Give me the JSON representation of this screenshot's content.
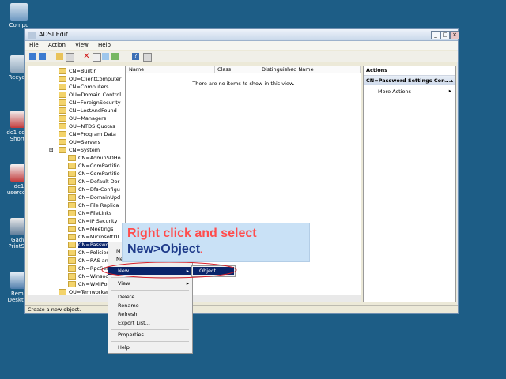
{
  "desktop": {
    "icons": [
      {
        "label": "Compu",
        "icon": "computer-icon"
      },
      {
        "label": "Recycle",
        "icon": "recycle-bin-icon"
      },
      {
        "label": "dc1 cons\nShortc",
        "icon": "shortcut-icon"
      },
      {
        "label": "dc1\nusercore",
        "icon": "shortcut-icon"
      },
      {
        "label": "Gadw\nPrintScr",
        "icon": "print-icon"
      },
      {
        "label": "Remo\nDesktop",
        "icon": "remote-desktop-icon"
      }
    ]
  },
  "window": {
    "title": "ADSI Edit",
    "menu": [
      "File",
      "Action",
      "View",
      "Help"
    ]
  },
  "tree": {
    "rows": [
      "CN=Builtin",
      "OU=ClientComputer",
      "CN=Computers",
      "OU=Domain Control",
      "CN=ForeignSecurity",
      "CN=LostAndFound",
      "OU=Managers",
      "OU=NTDS Quotas",
      "CN=Program Data",
      "OU=Servers",
      "CN=System",
      "CN=AdminSDHo",
      "CN=ComPartitio",
      "CN=ComPartitio",
      "CN=Default Dor",
      "CN=Dfs-Configu",
      "CN=DomainUpd",
      "CN=File Replica",
      "CN=FileLinks",
      "CN=IP Security",
      "CN=Meetings",
      "CN=MicrosoftDI",
      "CN=Passwor",
      "CN=Policies",
      "CN=RAS and",
      "CN=RpcSer",
      "CN=WinsocK",
      "CN=WMIPoli",
      "OU=Temworker"
    ],
    "selected": "CN=Passwor"
  },
  "list": {
    "columns": [
      "Name",
      "Class",
      "Distinguished Name"
    ],
    "empty_message": "There are no items to show in this view."
  },
  "actions": {
    "header": "Actions",
    "section": "CN=Password Settings Con...",
    "items": [
      "More Actions"
    ]
  },
  "context_menu": {
    "partial_items": [
      "M",
      "Ne"
    ],
    "items": [
      "New",
      "View",
      "Delete",
      "Rename",
      "Refresh",
      "Export List...",
      "Properties",
      "Help"
    ],
    "submenu": [
      "Object..."
    ]
  },
  "callout": {
    "line1": "Right click and select",
    "line2": "New>Object",
    "dot": "."
  },
  "status": {
    "text": "Create a new object."
  },
  "colors": {
    "desktop": "#1d5d86",
    "selection": "#0a246a",
    "callout_text": "#ff4d4d",
    "callout_accent": "#1f3b8a",
    "circle": "#d6202a"
  }
}
